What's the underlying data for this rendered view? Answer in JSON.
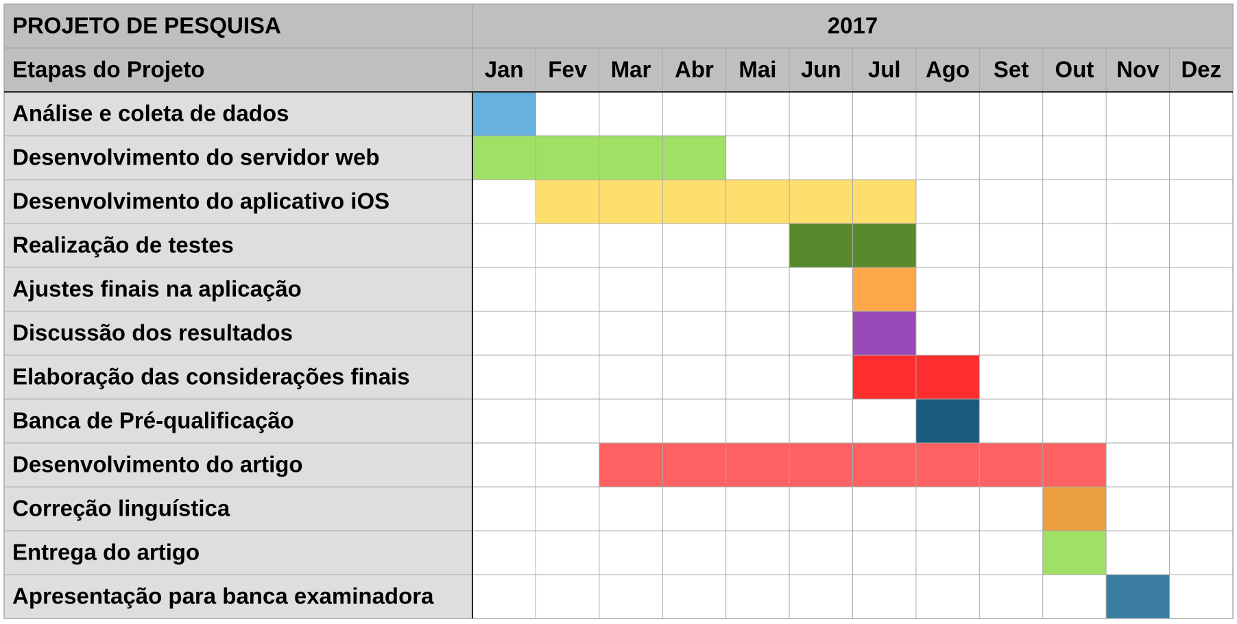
{
  "table": {
    "project_title": "PROJETO DE PESQUISA",
    "year": "2017",
    "stages_header": "Etapas do Projeto"
  },
  "chart_data": {
    "type": "table",
    "title": "PROJETO DE PESQUISA",
    "year": "2017",
    "row_header": "Etapas do Projeto",
    "months": [
      "Jan",
      "Fev",
      "Mar",
      "Abr",
      "Mai",
      "Jun",
      "Jul",
      "Ago",
      "Set",
      "Out",
      "Nov",
      "Dez"
    ],
    "tasks": [
      {
        "label": "Análise e coleta de dados",
        "start": "Jan",
        "end": "Jan",
        "color": "#67b1e0"
      },
      {
        "label": "Desenvolvimento do servidor web",
        "start": "Jan",
        "end": "Abr",
        "color": "#a0e064"
      },
      {
        "label": "Desenvolvimento do aplicativo iOS",
        "start": "Fev",
        "end": "Jul",
        "color": "#fedf6e"
      },
      {
        "label": "Realização de testes",
        "start": "Jun",
        "end": "Jul",
        "color": "#59892d"
      },
      {
        "label": "Ajustes finais na aplicação",
        "start": "Jul",
        "end": "Jul",
        "color": "#fea84a"
      },
      {
        "label": "Discussão dos resultados",
        "start": "Jul",
        "end": "Jul",
        "color": "#9a4ab8"
      },
      {
        "label": "Elaboração das considerações finais",
        "start": "Jul",
        "end": "Ago",
        "color": "#fe2e2e"
      },
      {
        "label": "Banca de Pré-qualificação",
        "start": "Ago",
        "end": "Ago",
        "color": "#1c5b7b"
      },
      {
        "label": "Desenvolvimento do artigo",
        "start": "Mar",
        "end": "Out",
        "color": "#fe6161"
      },
      {
        "label": "Correção linguística",
        "start": "Out",
        "end": "Out",
        "color": "#eb9e3e"
      },
      {
        "label": "Entrega do artigo",
        "start": "Out",
        "end": "Out",
        "color": "#a0e064"
      },
      {
        "label": "Apresentação para banca examinadora",
        "start": "Nov",
        "end": "Nov",
        "color": "#3b7ea1"
      }
    ]
  },
  "colors": {
    "header_bg": "#bebfbe",
    "label_bg": "#dedede",
    "grid_line": "#a9a9a9",
    "header_rule": "#222222"
  }
}
